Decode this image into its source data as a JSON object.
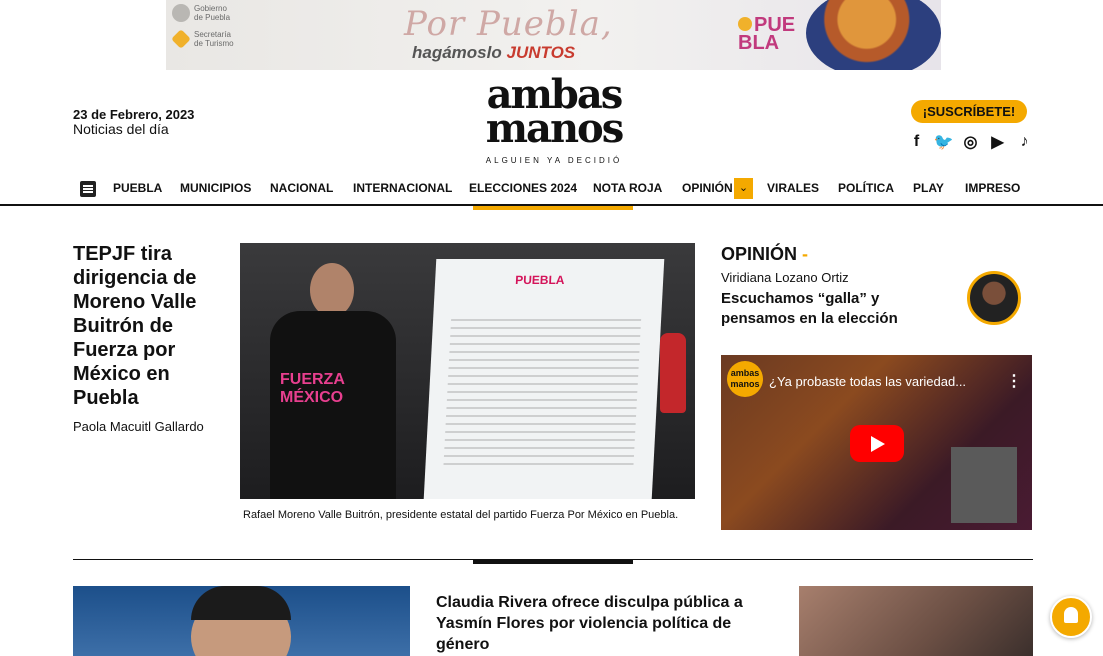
{
  "banner": {
    "gov_line1": "Gobierno",
    "gov_line2": "de Puebla",
    "sec_line1": "Secretaría",
    "sec_line2": "de Turismo",
    "por_puebla": "Por Puebla,",
    "hagamoslo": "hagámoslo",
    "juntos": "JUNTOS",
    "logo_line1": "PUE",
    "logo_line2": "BLA"
  },
  "header": {
    "date": "23 de Febrero, 2023",
    "subtitle": "Noticias del día",
    "logo_line1": "ambas",
    "logo_line2": "manos",
    "tagline": "ALGUIEN YA DECIDIÓ",
    "subscribe": "¡SUSCRÍBETE!",
    "social": [
      "f",
      "🐦",
      "◎",
      "▶",
      "♪"
    ]
  },
  "nav": {
    "items": [
      "PUEBLA",
      "MUNICIPIOS",
      "NACIONAL",
      "INTERNACIONAL",
      "ELECCIONES 2024",
      "NOTA ROJA",
      "OPINIÓN",
      "VIRALES",
      "POLÍTICA",
      "PLAY",
      "IMPRESO"
    ],
    "dropdown": "⌄"
  },
  "main_story": {
    "headline": "TEPJF tira dirigencia de Moreno Valle Buitrón de Fuerza por México en Puebla",
    "author": "Paola Macuitl Gallardo",
    "caption": "Rafael Moreno Valle Buitrón, presidente estatal del partido Fuerza Por México en Puebla.",
    "photo_board_title": "PUEBLA",
    "photo_shirt": "FUERZA MÉXICO"
  },
  "opinion": {
    "title": "OPINIÓN",
    "dash": "-",
    "author": "Viridiana Lozano Ortiz",
    "headline": "Escuchamos “galla” y pensamos en la elección"
  },
  "video": {
    "channel": "ambas manos",
    "title": "¿Ya probaste todas las variedad...",
    "menu": "⋮"
  },
  "bottom": {
    "headline": "Claudia Rivera ofrece disculpa pública a Yasmín Flores por violencia política de género"
  },
  "colors": {
    "accent": "#f4a900",
    "text": "#111111",
    "youtube_red": "#ff0000"
  }
}
